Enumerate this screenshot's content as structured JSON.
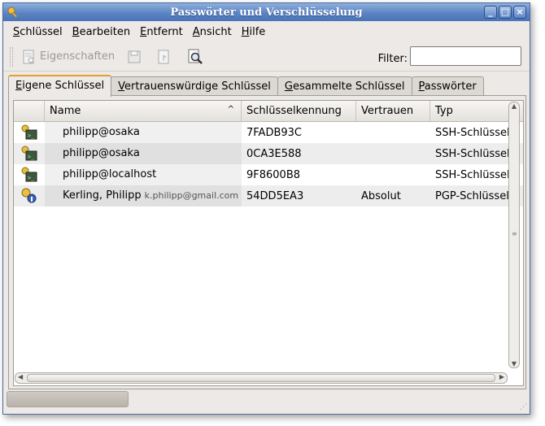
{
  "window": {
    "title": "Passwörter und Verschlüsselung"
  },
  "menubar": [
    {
      "first": "S",
      "rest": "chlüssel"
    },
    {
      "first": "B",
      "rest": "earbeiten"
    },
    {
      "first": "E",
      "rest": "ntfernt"
    },
    {
      "first": "A",
      "rest": "nsicht"
    },
    {
      "first": "H",
      "rest": "ilfe"
    }
  ],
  "toolbar": {
    "properties_label": "Eigenschaften",
    "filter_label": "Filter:",
    "filter_value": ""
  },
  "tabs": [
    {
      "first": "E",
      "rest": "igene Schlüssel",
      "active": true
    },
    {
      "first": "V",
      "rest": "ertrauenswürdige Schlüssel",
      "active": false
    },
    {
      "first": "G",
      "rest": "esammelte Schlüssel",
      "active": false
    },
    {
      "first": "P",
      "rest": "asswörter",
      "active": false
    }
  ],
  "table": {
    "columns": {
      "name": "Name",
      "key_id": "Schlüsselkennung",
      "trust": "Vertrauen",
      "type": "Typ"
    },
    "rows": [
      {
        "icon": "ssh-key-icon",
        "name": "philipp@osaka",
        "email": "",
        "key_id": "7FADB93C",
        "trust": "",
        "type": "SSH-Schlüssel"
      },
      {
        "icon": "ssh-key-icon",
        "name": "philipp@osaka",
        "email": "",
        "key_id": "0CA3E588",
        "trust": "",
        "type": "SSH-Schlüssel"
      },
      {
        "icon": "ssh-key-icon",
        "name": "philipp@localhost",
        "email": "",
        "key_id": "9F8600B8",
        "trust": "",
        "type": "SSH-Schlüssel"
      },
      {
        "icon": "pgp-key-icon",
        "name": "Kerling, Philipp",
        "email": "k.philipp@gmail.com",
        "key_id": "54DD5EA3",
        "trust": "Absolut",
        "type": "PGP-Schlüssel"
      }
    ]
  }
}
